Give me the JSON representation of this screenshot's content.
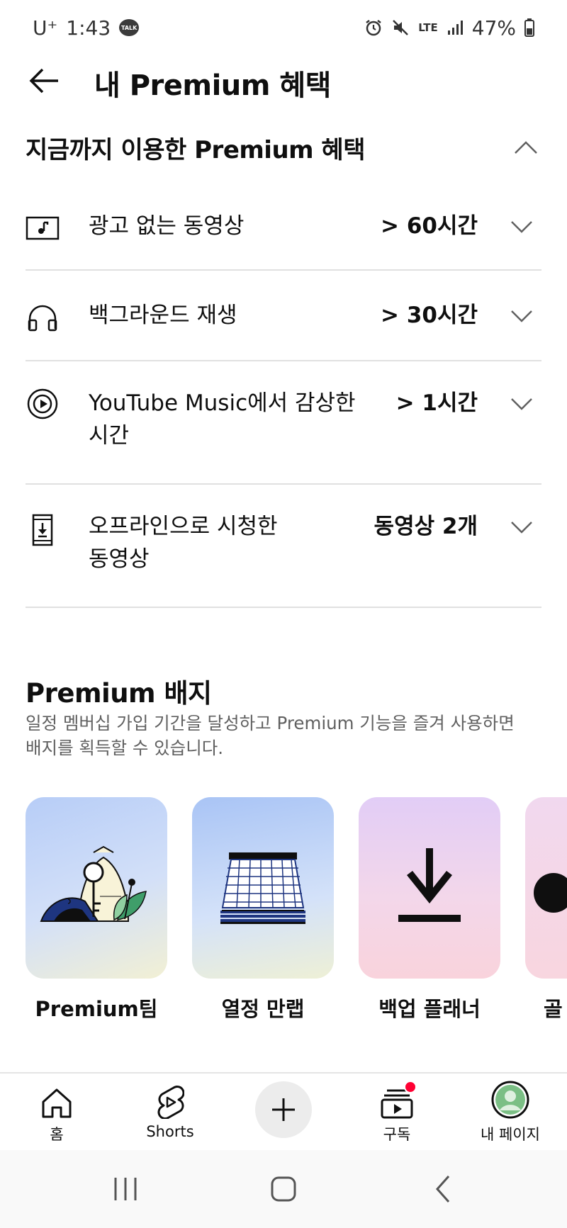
{
  "status_bar": {
    "carrier": "U⁺",
    "time": "1:43",
    "talk_badge": "TALK",
    "network": "LTE",
    "battery": "47%"
  },
  "header": {
    "title": "내 Premium 혜택"
  },
  "benefits_section": {
    "title": "지금까지 이용한 Premium 혜택",
    "rows": [
      {
        "icon": "video-icon",
        "label": "광고 없는 동영상",
        "value": "> 60시간"
      },
      {
        "icon": "headphones-icon",
        "label": "백그라운드 재생",
        "value": "> 30시간"
      },
      {
        "icon": "youtube-music-icon",
        "label_line1": "YouTube Music에서 감상한",
        "label_line2": "시간",
        "value": "> 1시간"
      },
      {
        "icon": "offline-download-icon",
        "label_line1": "오프라인으로 시청한",
        "label_line2": "동영상",
        "value": "동영상 2개"
      }
    ]
  },
  "badges_section": {
    "title": "Premium 배지",
    "description_line1": "일정 멤버십 가입 기간을 달성하고 Premium 기능을 즐겨 사용하면",
    "description_line2": "배지를 획득할 수 있습니다.",
    "badges": [
      {
        "name": "Premium팀",
        "icon": "key-illustration-icon"
      },
      {
        "name": "열정 만랩",
        "icon": "calendar-illustration-icon"
      },
      {
        "name": "백업 플래너",
        "icon": "download-arrow-icon"
      },
      {
        "name": "골",
        "icon": "partial-badge-icon"
      }
    ]
  },
  "bottom_nav": {
    "home": "홈",
    "shorts": "Shorts",
    "subscriptions": "구독",
    "my_page": "내 페이지"
  },
  "colors": {
    "text_primary": "#0f0f0f",
    "text_secondary": "#606060",
    "divider": "#e0e0e0",
    "notification_dot": "#ff0033"
  }
}
